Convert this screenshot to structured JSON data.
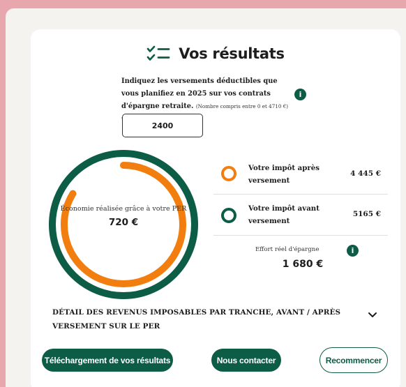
{
  "header": {
    "title": "Vos résultats",
    "icon": "checklist-icon"
  },
  "question": {
    "text": "Indiquez les versements déductibles que vous planifiez en 2025 sur vos contrats d'épargne retraite.",
    "hint": "(Nombre compris entre 0 et 4710 €) *",
    "input_value": "2400"
  },
  "donut": {
    "label": "Économie réalisée grâce à votre PER",
    "value": "720 €",
    "ratio": 0.837
  },
  "taxes": [
    {
      "label": "Votre impôt après versement",
      "value": "4 445 €",
      "marker": "orange"
    },
    {
      "label": "Votre impôt avant versement",
      "value": "5165 €",
      "marker": "green"
    }
  ],
  "effort": {
    "label": "Effort réel d'épargne",
    "value": "1 680 €"
  },
  "detail": {
    "text": "DÉTAIL DES REVENUS IMPOSABLES PAR TRANCHE, AVANT / APRÈS VERSEMENT SUR LE PER"
  },
  "buttons": {
    "download": "Téléchargement de vos résultats",
    "contact": "Nous contacter",
    "restart": "Recommencer"
  },
  "colors": {
    "primary_green": "#0d5c45",
    "accent_orange": "#f17e0e",
    "background_pink": "#e8a7ad"
  }
}
